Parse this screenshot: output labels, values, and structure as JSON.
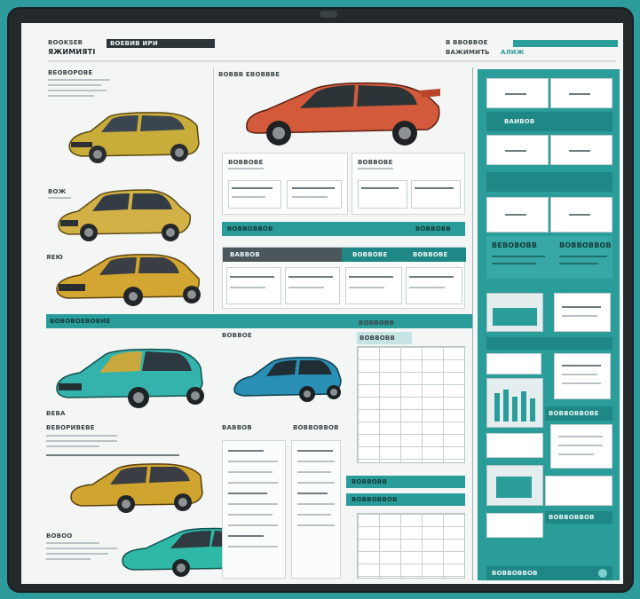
{
  "header": {
    "brand_top": "BOOKSEB",
    "brand_bottom": "ЯЖИМИЯТІ",
    "tab_label": "ВОЕВИВ ИРИ",
    "right_code": "В ВВОВВОЕ",
    "right_sub": "ВАЖИМИТЬ",
    "right_badge": "АЛИЖ"
  },
  "left_column": {
    "top_caption": "ВЕОВОРОВЕ",
    "label_2": "ВОЖ",
    "label_3": "ЯЕЮ",
    "section_band": "ВОВОВОЕВОВИЕ",
    "label_5": "ВЕВА",
    "label_5b": "ВЕВОРИВЕВЕ",
    "label_6": "ВОВОО"
  },
  "middle_column": {
    "hero_caption": "ВОВВВ ЕВОВВВЕ",
    "card_a_title": "ВОВВОВЕ",
    "card_b_title": "ВОВВОВЕ",
    "band_left": "ВОВВОВВОВ",
    "band_right": "ВОВВОВВ",
    "tbl_head_a": "ВАВВОВ",
    "tbl_head_b": "ВОВВОВЕ",
    "tbl_head_c": "ВОВВОВЕ",
    "car_caption": "ВОВВОЕ",
    "sub_a": "ВАВВОВ",
    "sub_b": "ВОВВОВВОВ",
    "stat_title": "ВОВВОВВ",
    "stat_sub": "ВОВВОВВ",
    "bottom_band_a": "ВОВВОВВ",
    "bottom_band_b": "ВОВВОВВОВ"
  },
  "right_column": {
    "block_a": "ВАИВОВ",
    "promo_left": "ВЕВОВОВВ",
    "promo_right": "ВОВВОВВОВ",
    "band_mid": "ВОВВОВВОВЕ",
    "band_low": "ВОВВОВВОВ",
    "footer_label": "ВОВВОВВОВ"
  },
  "colors": {
    "teal": "#2a9c9a",
    "teal_dark": "#1f8785",
    "frame": "#24292c"
  }
}
